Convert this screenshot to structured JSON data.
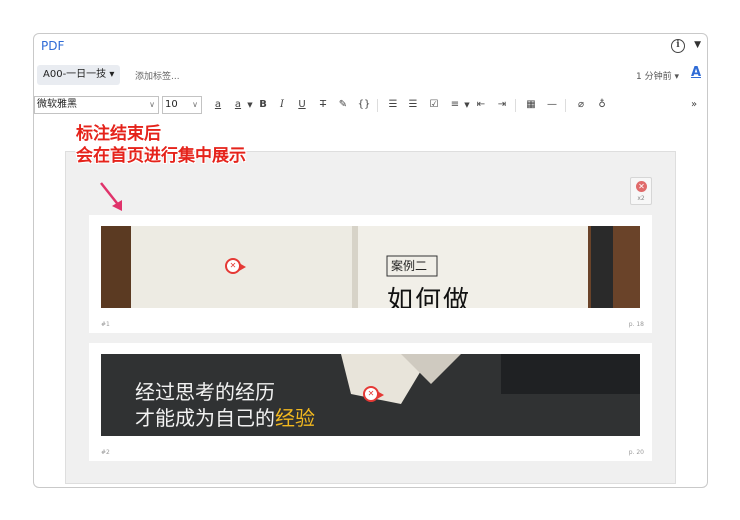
{
  "window": {
    "title": "PDF"
  },
  "tagbar": {
    "tag": "A00-一日一技",
    "add_tag": "添加标签...",
    "time": "1 分钟前"
  },
  "toolbar": {
    "font": "微软雅黑",
    "size": "10",
    "buttons": [
      "a",
      "B",
      "I",
      "U",
      "T",
      "ⓟ",
      "{}",
      "☰",
      "☰",
      "☑",
      "≡",
      "⇤",
      "⇥",
      "▦",
      "—",
      "🔗",
      "♀"
    ]
  },
  "callout": {
    "line1": "标注结束后",
    "line2": "会在首页进行集中展示"
  },
  "badge": {
    "count": "x2"
  },
  "cards": [
    {
      "index": "#1",
      "page": "p. 18",
      "image_label_box": "案例二",
      "image_heading": "如何做"
    },
    {
      "index": "#2",
      "page": "p. 20",
      "line1": "经过思考的经历",
      "line2_white": "才能成为自己的",
      "line2_gold": "经验"
    }
  ],
  "colors": {
    "accent": "#2f6bd6",
    "annotation_red": "#e53935",
    "gold": "#f2b81f"
  }
}
